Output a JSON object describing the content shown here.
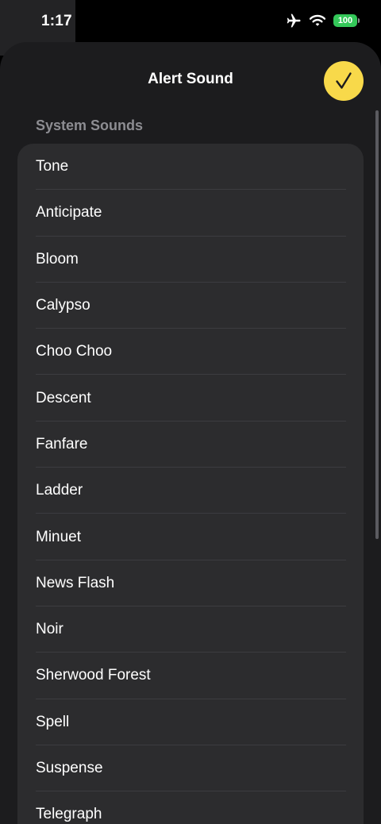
{
  "status_bar": {
    "time": "1:17",
    "battery": "100",
    "icons": [
      "airplane-mode-icon",
      "wifi-icon",
      "battery-icon"
    ]
  },
  "sheet": {
    "title": "Alert Sound",
    "done_icon": "checkmark-icon"
  },
  "section": {
    "header": "System Sounds",
    "items": [
      {
        "label": "Tone"
      },
      {
        "label": "Anticipate"
      },
      {
        "label": "Bloom"
      },
      {
        "label": "Calypso"
      },
      {
        "label": "Choo Choo"
      },
      {
        "label": "Descent"
      },
      {
        "label": "Fanfare"
      },
      {
        "label": "Ladder"
      },
      {
        "label": "Minuet"
      },
      {
        "label": "News Flash"
      },
      {
        "label": "Noir"
      },
      {
        "label": "Sherwood Forest"
      },
      {
        "label": "Spell"
      },
      {
        "label": "Suspense"
      },
      {
        "label": "Telegraph"
      }
    ]
  },
  "colors": {
    "accent": "#f8d94a",
    "sheet_background": "#1c1c1e",
    "list_background": "#2c2c2e",
    "battery_green": "#34c759"
  }
}
